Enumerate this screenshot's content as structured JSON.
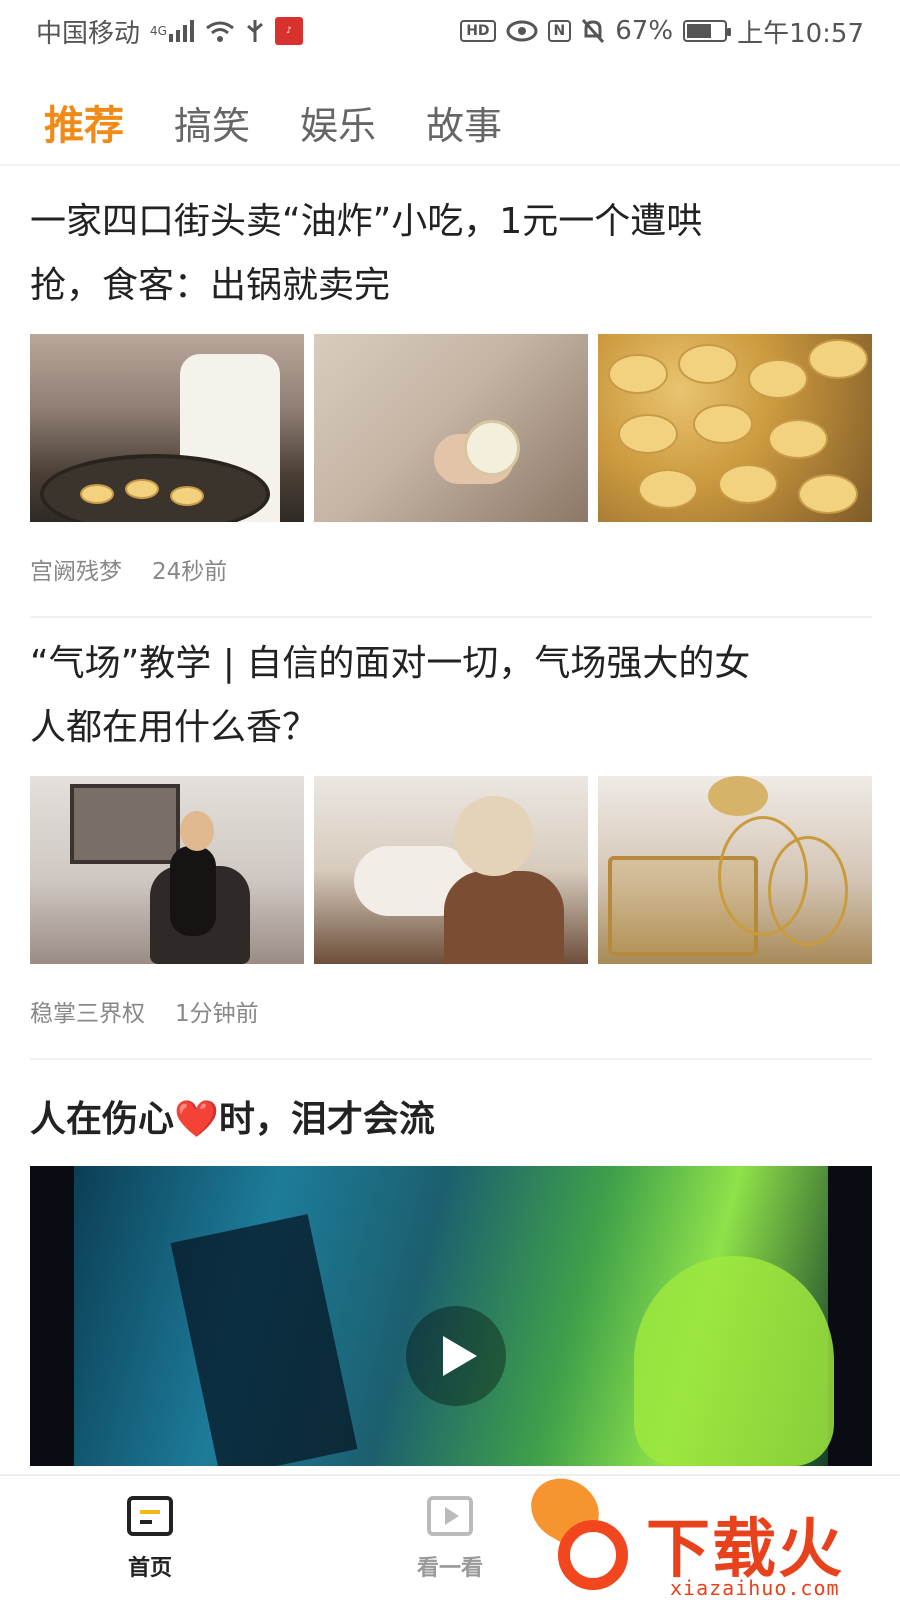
{
  "status_bar": {
    "carrier": "中国移动",
    "network": "4G",
    "battery_percent": "67%",
    "battery_level": 0.67,
    "time": "上午10:57",
    "hd_label": "HD",
    "nfc_label": "N"
  },
  "tabs": [
    {
      "label": "推荐",
      "active": true
    },
    {
      "label": "搞笑",
      "active": false
    },
    {
      "label": "娱乐",
      "active": false
    },
    {
      "label": "故事",
      "active": false
    }
  ],
  "articles": [
    {
      "title_line1": "一家四口街头卖“油炸”小吃，1元一个遭哄",
      "title_line2": "抢，食客：出锅就卖完",
      "author": "宫阙残梦",
      "time": "24秒前"
    },
    {
      "title_line1": "“气场”教学 | 自信的面对一切，气场强大的女",
      "title_line2": "人都在用什么香？",
      "author": "稳掌三界权",
      "time": "1分钟前"
    }
  ],
  "video": {
    "title_pre": "人在伤心",
    "title_emoji": "❤️",
    "title_post": "时，泪才会流"
  },
  "bottom_nav": {
    "home_label": "首页",
    "watch_label": "看一看"
  },
  "watermark": {
    "brand_cn": "下载火",
    "brand_url": "xiazaihuo.com"
  },
  "colors": {
    "accent": "#f08a18",
    "watermark": "#e8421c"
  }
}
